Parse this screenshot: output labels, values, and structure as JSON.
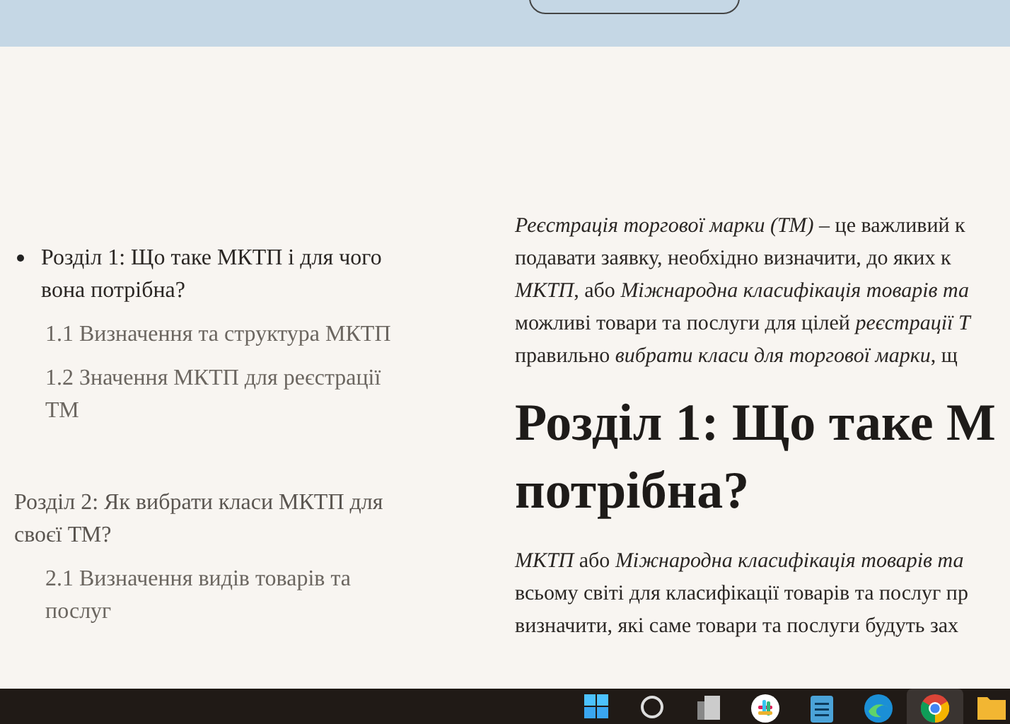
{
  "toc": [
    {
      "label": "Розділ 1: Що таке МКТП і для чого вона потрібна?",
      "selected": true,
      "children": [
        {
          "label": "1.1 Визначення та структура МКТП"
        },
        {
          "label": "1.2 Значення МКТП для реєстрації ТМ"
        }
      ]
    },
    {
      "label": "Розділ 2: Як вибрати класи МКТП для своєї ТМ?",
      "selected": false,
      "children": [
        {
          "label": "2.1 Визначення видів товарів та послуг"
        }
      ]
    }
  ],
  "article": [
    {
      "kind": "paragraph",
      "lines": [
        "*Реєстрація торгової марки (ТМ)* – це важливий к",
        "подавати заявку, необхідно визначити, до яких к",
        "*МКТП*, або *Міжнародна класифікація товарів та*",
        "можливі товари та послуги для цілей *реєстрації Т*",
        "правильно *вибрати класи для торгової марки*, щ"
      ]
    },
    {
      "kind": "heading",
      "lines": [
        "Розділ 1: Що таке М",
        "потрібна?"
      ]
    },
    {
      "kind": "paragraph",
      "lines": [
        "*МКТП* або *Міжнародна класифікація товарів та*",
        "всьому світі для класифікації товарів та послуг пр",
        "визначити, які саме товари та послуги будуть зах"
      ]
    }
  ],
  "taskbar": [
    {
      "kind": "start",
      "active": false
    },
    {
      "kind": "search",
      "active": false
    },
    {
      "kind": "taskview",
      "active": false
    },
    {
      "kind": "chat",
      "active": false
    },
    {
      "kind": "notepad",
      "active": false
    },
    {
      "kind": "edge",
      "active": false
    },
    {
      "kind": "chrome",
      "active": true
    },
    {
      "kind": "folder",
      "active": false
    }
  ]
}
